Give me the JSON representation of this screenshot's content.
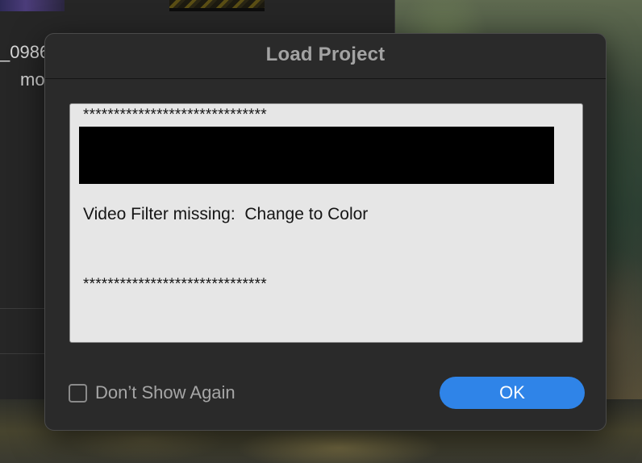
{
  "background": {
    "left_panel": {
      "clip_name_fragment": "_0986",
      "secondary_fragment": "mo"
    }
  },
  "dialog": {
    "title": "Load Project",
    "message": {
      "separator_top": "******************************",
      "missing_item": "Video Filter missing:  Change to Color",
      "separator_bottom": "******************************"
    },
    "dont_show_again": {
      "label": "Don’t Show Again",
      "checked": false
    },
    "ok_button_label": "OK"
  },
  "colors": {
    "dialog_bg": "#2a2a2a",
    "message_bg": "#e6e6e6",
    "accent_button": "#2f84e8",
    "redaction": "#000000"
  }
}
